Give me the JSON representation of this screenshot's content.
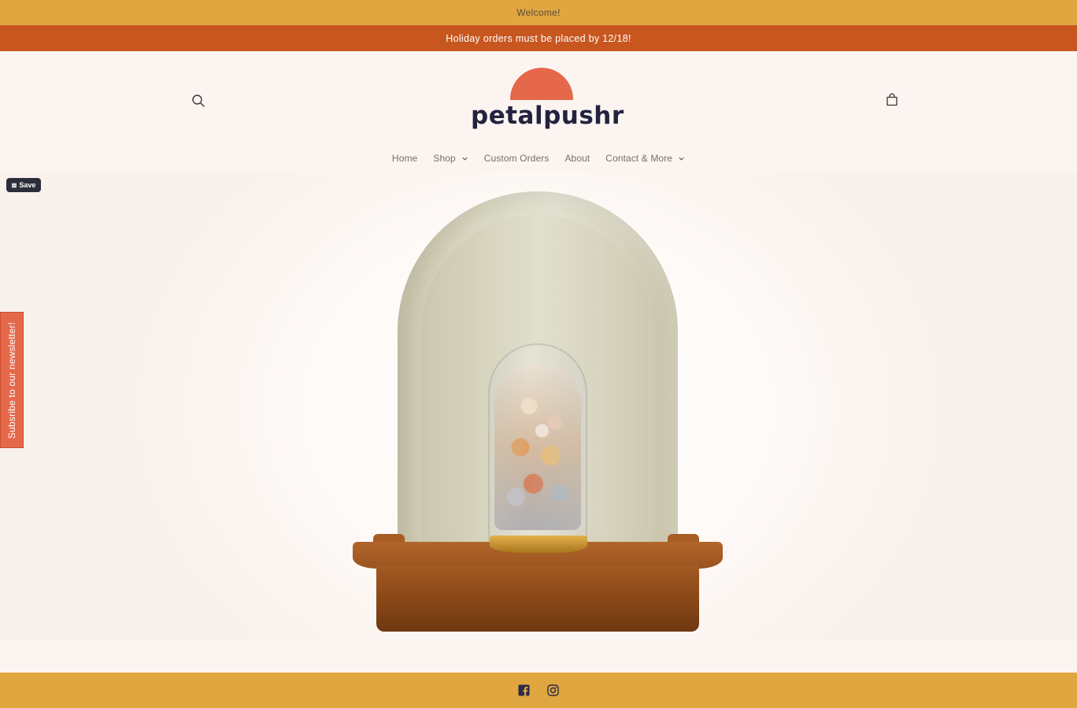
{
  "announcements": {
    "welcome": "Welcome!",
    "holiday": "Holiday orders must be placed by 12/18!"
  },
  "header": {
    "logo_text": "petalpushr",
    "search_icon": "search-icon",
    "cart_icon": "cart-icon"
  },
  "nav": {
    "items": [
      {
        "label": "Home",
        "dropdown": false
      },
      {
        "label": "Shop",
        "dropdown": true
      },
      {
        "label": "Custom Orders",
        "dropdown": false
      },
      {
        "label": "About",
        "dropdown": false
      },
      {
        "label": "Contact & More",
        "dropdown": true
      }
    ]
  },
  "hero": {
    "save_label": "Save",
    "save_icon": "save-icon"
  },
  "newsletter": {
    "label": "Subsribe to our newsletter!"
  },
  "footer": {
    "social": [
      "facebook-icon",
      "instagram-icon"
    ]
  },
  "colors": {
    "welcome_bar": "#e0a640",
    "holiday_bar": "#c8561f",
    "logo_sun": "#e5684a",
    "logo_text": "#23233f",
    "newsletter_tab": "#e5684a",
    "footer": "#e0a640",
    "page_background": "#fcf4f1"
  }
}
